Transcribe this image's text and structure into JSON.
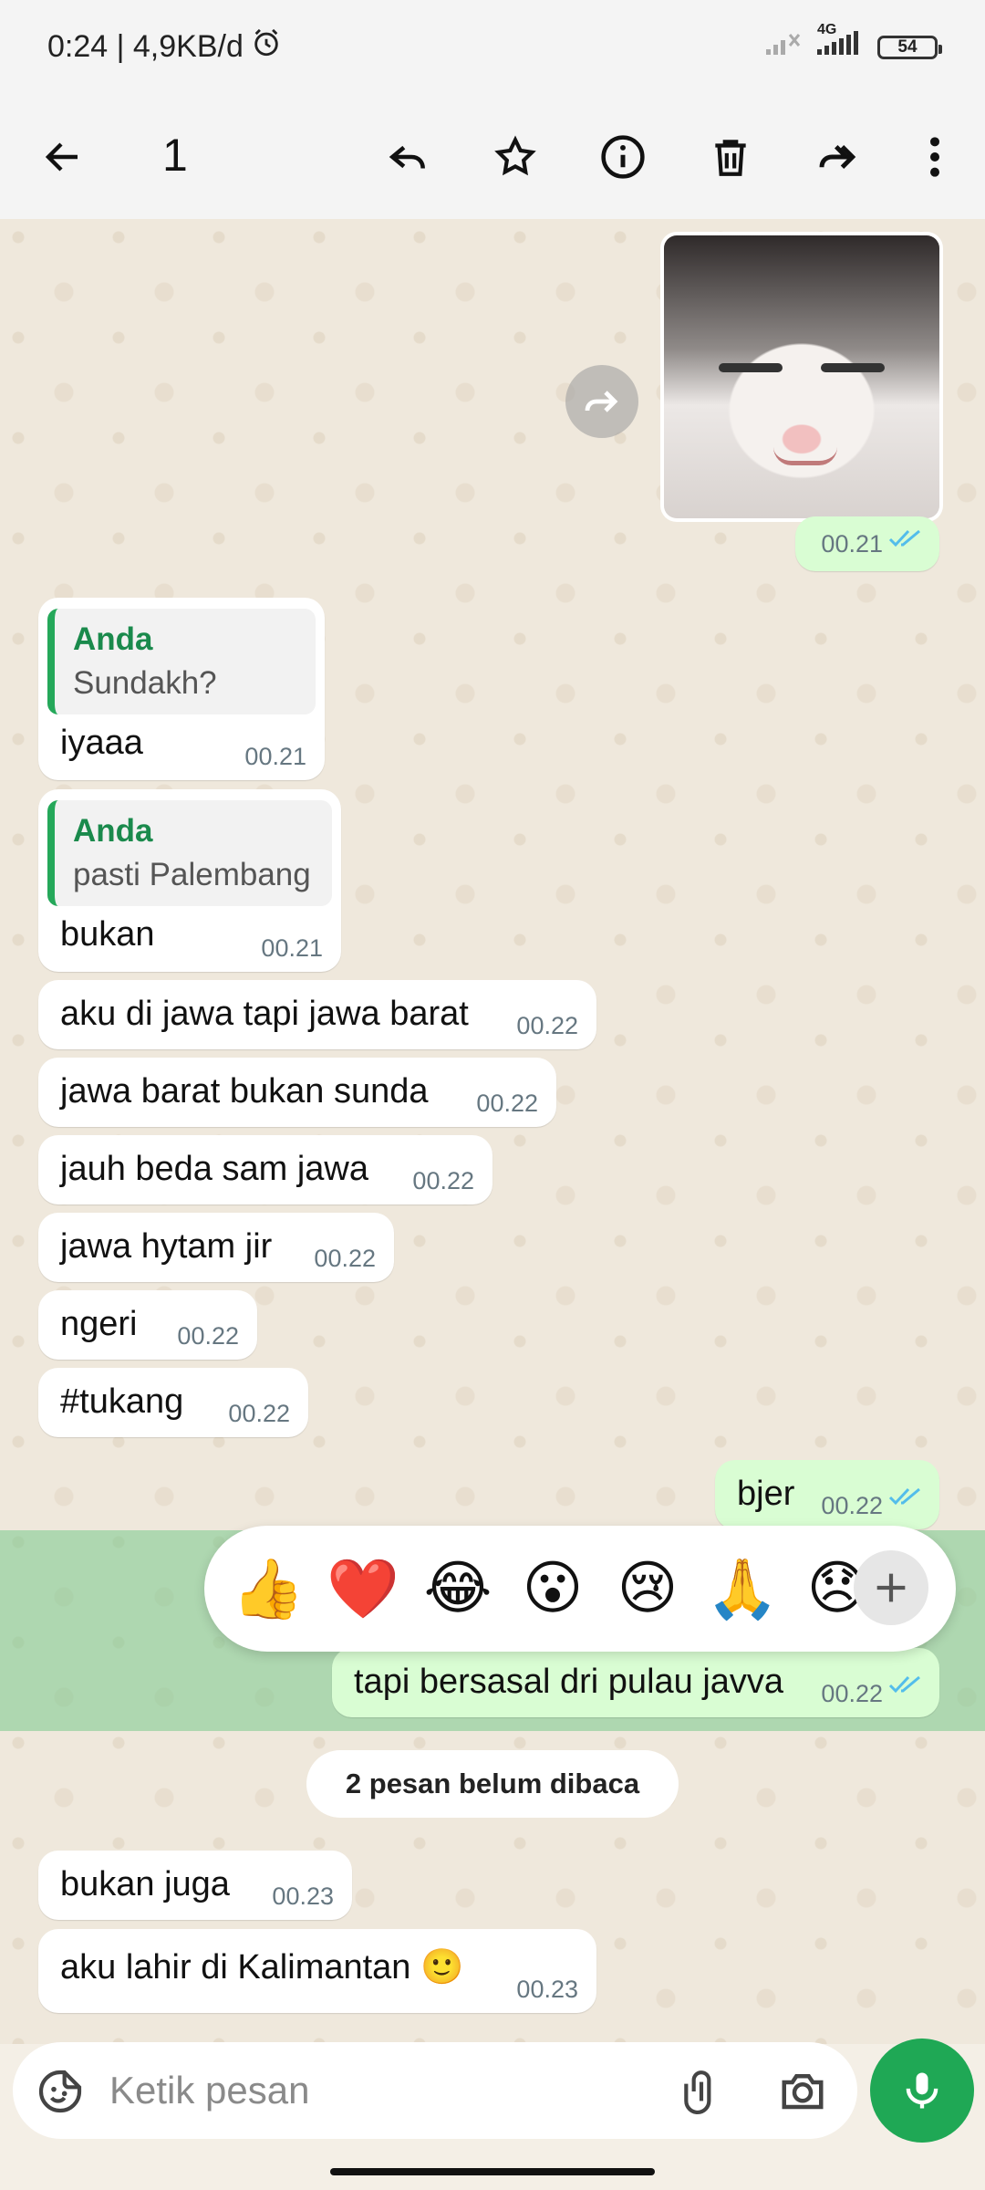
{
  "status_bar": {
    "time_speed": "0:24 | 4,9KB/d",
    "network": "4G",
    "battery": "54"
  },
  "action_bar": {
    "selected_count": "1"
  },
  "messages": {
    "image_time": "00.21",
    "m1_quote_name": "Anda",
    "m1_quote_text": "Sundakh?",
    "m1_text": "iyaaa",
    "m1_time": "00.21",
    "m2_quote_name": "Anda",
    "m2_quote_text": "pasti Palembang",
    "m2_text": "bukan",
    "m2_time": "00.21",
    "m3_text": "aku di jawa tapi jawa barat",
    "m3_time": "00.22",
    "m4_text": "jawa barat bukan sunda",
    "m4_time": "00.22",
    "m5_text": "jauh beda sam jawa",
    "m5_time": "00.22",
    "m6_text": "jawa hytam jir",
    "m6_time": "00.22",
    "m7_text": "ngeri",
    "m7_time": "00.22",
    "m8_text": "#tukang",
    "m8_time": "00.22",
    "m9_text": "bjer",
    "m9_time": "00.22",
    "m10_text": "tapi bersasal dri pulau javva",
    "m10_time": "00.22",
    "unread": "2 pesan belum dibaca",
    "m11_text": "bukan juga",
    "m11_time": "00.23",
    "m12_text": "aku lahir di Kalimantan 🙂",
    "m12_time": "00.23"
  },
  "reactions": [
    "👍",
    "❤️",
    "😂",
    "😮",
    "😢",
    "🙏",
    "😞"
  ],
  "input": {
    "placeholder": "Ketik pesan"
  },
  "colors": {
    "accent_green": "#1fa855",
    "outgoing_bubble": "#d9fdd3",
    "read_ticks": "#53bdeb"
  }
}
